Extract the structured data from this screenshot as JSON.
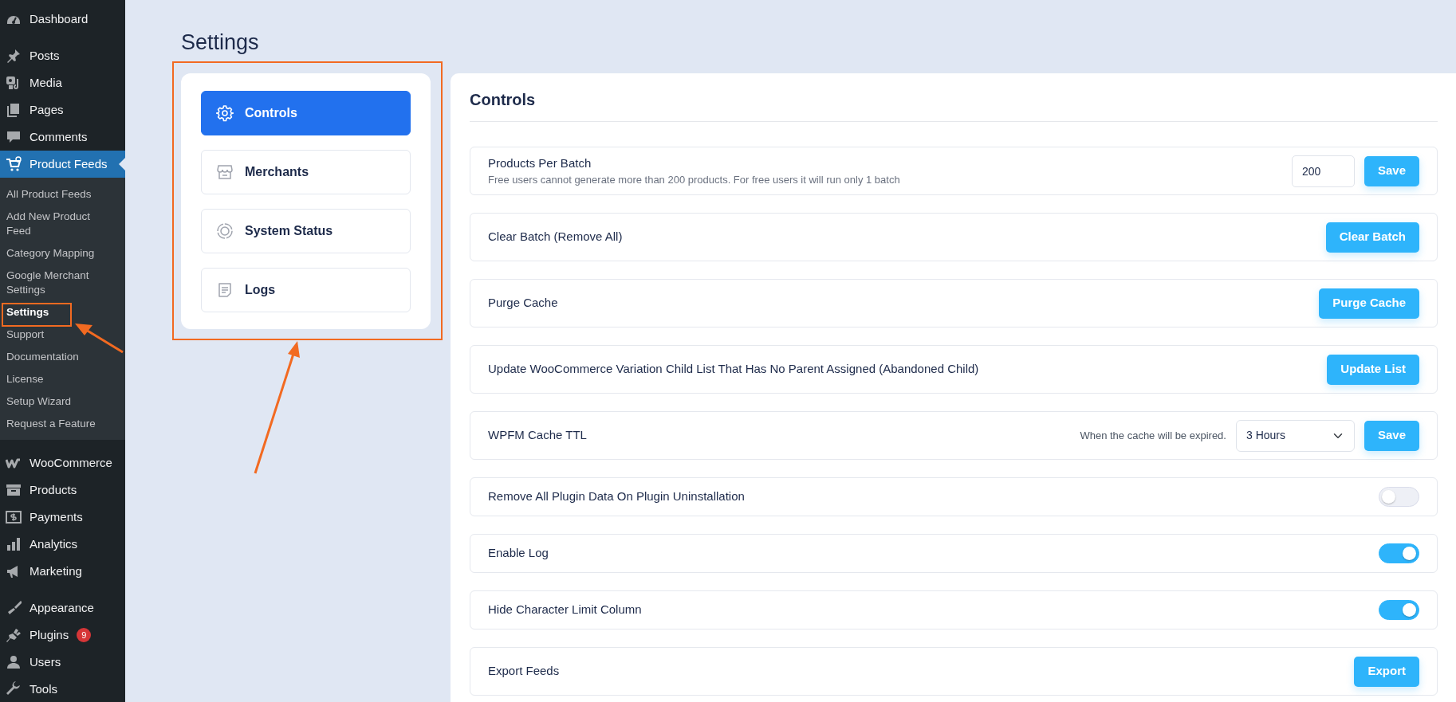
{
  "sidebar": {
    "groups": [
      [
        {
          "label": "Dashboard",
          "selected": false
        }
      ],
      [
        {
          "label": "Posts",
          "selected": false
        },
        {
          "label": "Media",
          "selected": false
        },
        {
          "label": "Pages",
          "selected": false
        },
        {
          "label": "Comments",
          "selected": false
        },
        {
          "label": "Product Feeds",
          "selected": true,
          "children": [
            {
              "label": "All Product Feeds",
              "selected": false
            },
            {
              "label": "Add New Product Feed",
              "selected": false
            },
            {
              "label": "Category Mapping",
              "selected": false
            },
            {
              "label": "Google Merchant Settings",
              "selected": false
            },
            {
              "label": "Settings",
              "selected": true
            },
            {
              "label": "Support",
              "selected": false
            },
            {
              "label": "Documentation",
              "selected": false
            },
            {
              "label": "License",
              "selected": false
            },
            {
              "label": "Setup Wizard",
              "selected": false
            },
            {
              "label": "Request a Feature",
              "selected": false
            }
          ]
        }
      ],
      [
        {
          "label": "WooCommerce",
          "selected": false
        },
        {
          "label": "Products",
          "selected": false
        },
        {
          "label": "Payments",
          "selected": false
        },
        {
          "label": "Analytics",
          "selected": false
        },
        {
          "label": "Marketing",
          "selected": false
        }
      ],
      [
        {
          "label": "Appearance",
          "selected": false
        },
        {
          "label": "Plugins",
          "selected": false,
          "badge": "9"
        },
        {
          "label": "Users",
          "selected": false
        },
        {
          "label": "Tools",
          "selected": false
        }
      ]
    ]
  },
  "page_title": "Settings",
  "tabs": [
    {
      "label": "Controls",
      "selected": true
    },
    {
      "label": "Merchants",
      "selected": false
    },
    {
      "label": "System Status",
      "selected": false
    },
    {
      "label": "Logs",
      "selected": false
    }
  ],
  "panel": {
    "title": "Controls",
    "rows": [
      {
        "kind": "input",
        "label": "Products Per Batch",
        "description": "Free users cannot generate more than 200 products. For free users it will run only 1 batch",
        "value": "200",
        "button": "Save"
      },
      {
        "kind": "button",
        "label": "Clear Batch (Remove All)",
        "button": "Clear Batch"
      },
      {
        "kind": "button",
        "label": "Purge Cache",
        "button": "Purge Cache"
      },
      {
        "kind": "button",
        "label": "Update WooCommerce Variation Child List That Has No Parent Assigned (Abandoned Child)",
        "button": "Update List"
      },
      {
        "kind": "select",
        "label": "WPFM Cache TTL",
        "hint": "When the cache will be expired.",
        "value": "3 Hours",
        "button": "Save"
      },
      {
        "kind": "toggle",
        "label": "Remove All Plugin Data On Plugin Uninstallation",
        "on": false
      },
      {
        "kind": "toggle",
        "label": "Enable Log",
        "on": true
      },
      {
        "kind": "toggle",
        "label": "Hide Character Limit Column",
        "on": true
      },
      {
        "kind": "button",
        "label": "Export Feeds",
        "button": "Export"
      }
    ]
  }
}
